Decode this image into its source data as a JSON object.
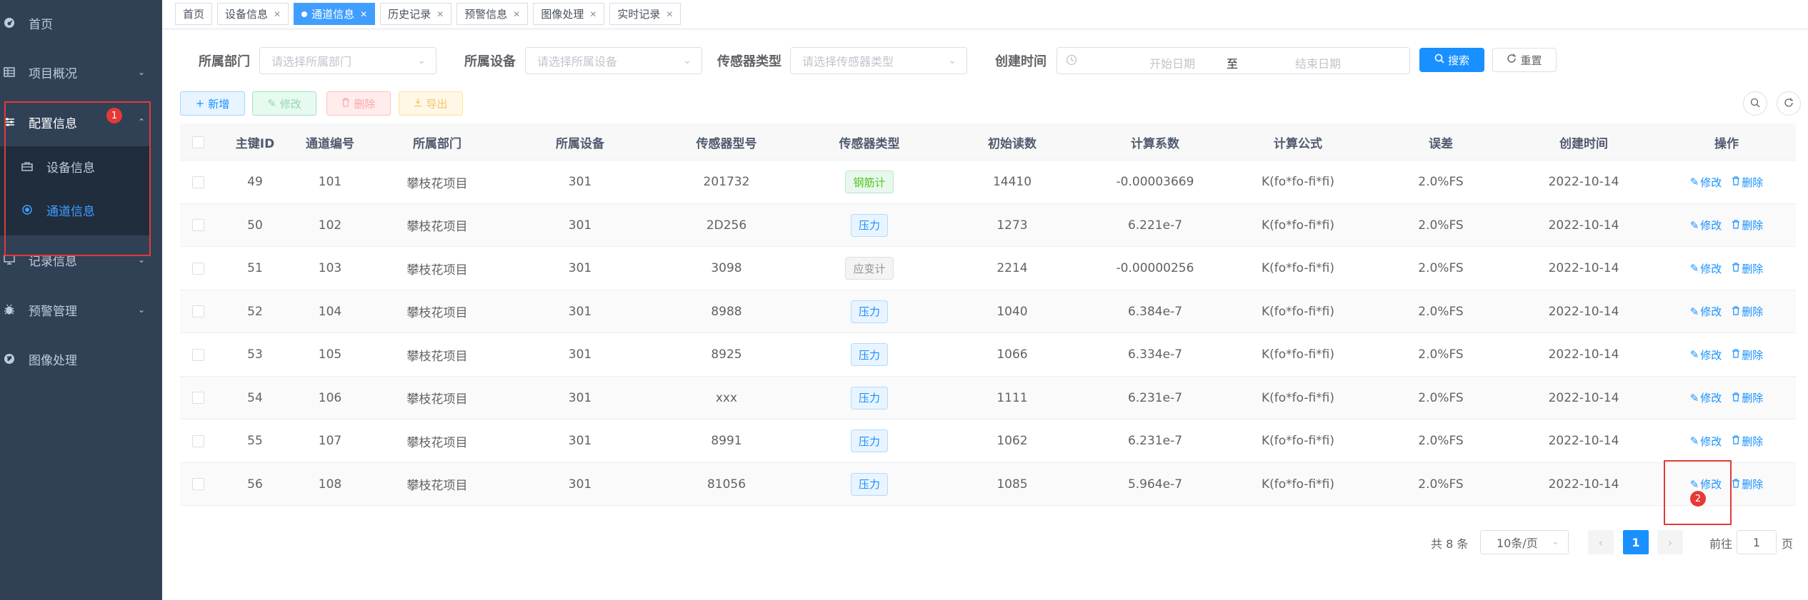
{
  "colors": {
    "sidebar_bg": "#304156",
    "submenu_bg": "#1f2d3d",
    "primary": "#1890ff",
    "annotation": "#e53935"
  },
  "sidebar": {
    "items": [
      {
        "label": "首页",
        "icon": "dashboard-icon"
      },
      {
        "label": "项目概况",
        "icon": "table-icon"
      },
      {
        "label": "配置信息",
        "icon": "sliders-icon"
      },
      {
        "label": "记录信息",
        "icon": "monitor-icon"
      },
      {
        "label": "预警管理",
        "icon": "bug-icon"
      },
      {
        "label": "图像处理",
        "icon": "globe-icon"
      }
    ],
    "sub_items": [
      {
        "label": "设备信息",
        "icon": "briefcase-icon"
      },
      {
        "label": "通道信息",
        "icon": "radio-dot-icon"
      }
    ]
  },
  "tags": [
    {
      "label": "首页",
      "closable": false,
      "active": false
    },
    {
      "label": "设备信息",
      "closable": true,
      "active": false
    },
    {
      "label": "通道信息",
      "closable": true,
      "active": true
    },
    {
      "label": "历史记录",
      "closable": true,
      "active": false
    },
    {
      "label": "预警信息",
      "closable": true,
      "active": false
    },
    {
      "label": "图像处理",
      "closable": true,
      "active": false
    },
    {
      "label": "实时记录",
      "closable": true,
      "active": false
    }
  ],
  "search": {
    "dept_label": "所属部门",
    "dept_placeholder": "请选择所属部门",
    "device_label": "所属设备",
    "device_placeholder": "请选择所属设备",
    "sensor_label": "传感器类型",
    "sensor_placeholder": "请选择传感器类型",
    "created_label": "创建时间",
    "start_placeholder": "开始日期",
    "range_sep": "至",
    "end_placeholder": "结束日期",
    "search_button": "搜索",
    "reset_button": "重置"
  },
  "toolbar": {
    "add": "新增",
    "edit": "修改",
    "delete": "删除",
    "export": "导出"
  },
  "table": {
    "headers": [
      "主键ID",
      "通道编号",
      "所属部门",
      "所属设备",
      "传感器型号",
      "传感器类型",
      "初始读数",
      "计算系数",
      "计算公式",
      "误差",
      "创建时间",
      "操作"
    ],
    "op_edit": "修改",
    "op_delete": "删除",
    "rows": [
      {
        "id": "49",
        "channel": "101",
        "dept": "攀枝花项目",
        "device": "301",
        "model": "201732",
        "type": "钢筋计",
        "type_style": "green",
        "init": "14410",
        "coef": "-0.00003669",
        "formula": "K(fo*fo-fi*fi)",
        "error": "2.0%FS",
        "created": "2022-10-14"
      },
      {
        "id": "50",
        "channel": "102",
        "dept": "攀枝花项目",
        "device": "301",
        "model": "2D256",
        "type": "压力",
        "type_style": "blue",
        "init": "1273",
        "coef": "6.221e-7",
        "formula": "K(fo*fo-fi*fi)",
        "error": "2.0%FS",
        "created": "2022-10-14"
      },
      {
        "id": "51",
        "channel": "103",
        "dept": "攀枝花项目",
        "device": "301",
        "model": "3098",
        "type": "应变计",
        "type_style": "gray",
        "init": "2214",
        "coef": "-0.00000256",
        "formula": "K(fo*fo-fi*fi)",
        "error": "2.0%FS",
        "created": "2022-10-14"
      },
      {
        "id": "52",
        "channel": "104",
        "dept": "攀枝花项目",
        "device": "301",
        "model": "8988",
        "type": "压力",
        "type_style": "blue",
        "init": "1040",
        "coef": "6.384e-7",
        "formula": "K(fo*fo-fi*fi)",
        "error": "2.0%FS",
        "created": "2022-10-14"
      },
      {
        "id": "53",
        "channel": "105",
        "dept": "攀枝花项目",
        "device": "301",
        "model": "8925",
        "type": "压力",
        "type_style": "blue",
        "init": "1066",
        "coef": "6.334e-7",
        "formula": "K(fo*fo-fi*fi)",
        "error": "2.0%FS",
        "created": "2022-10-14"
      },
      {
        "id": "54",
        "channel": "106",
        "dept": "攀枝花项目",
        "device": "301",
        "model": "xxx",
        "type": "压力",
        "type_style": "blue",
        "init": "1111",
        "coef": "6.231e-7",
        "formula": "K(fo*fo-fi*fi)",
        "error": "2.0%FS",
        "created": "2022-10-14"
      },
      {
        "id": "55",
        "channel": "107",
        "dept": "攀枝花项目",
        "device": "301",
        "model": "8991",
        "type": "压力",
        "type_style": "blue",
        "init": "1062",
        "coef": "6.231e-7",
        "formula": "K(fo*fo-fi*fi)",
        "error": "2.0%FS",
        "created": "2022-10-14"
      },
      {
        "id": "56",
        "channel": "108",
        "dept": "攀枝花项目",
        "device": "301",
        "model": "81056",
        "type": "压力",
        "type_style": "blue",
        "init": "1085",
        "coef": "5.964e-7",
        "formula": "K(fo*fo-fi*fi)",
        "error": "2.0%FS",
        "created": "2022-10-14"
      }
    ]
  },
  "pagination": {
    "total": "共 8 条",
    "page_size": "10条/页",
    "current": "1",
    "goto_prefix": "前往",
    "goto_value": "1",
    "goto_suffix": "页"
  },
  "annotations": [
    {
      "label": "1"
    },
    {
      "label": "2"
    }
  ]
}
